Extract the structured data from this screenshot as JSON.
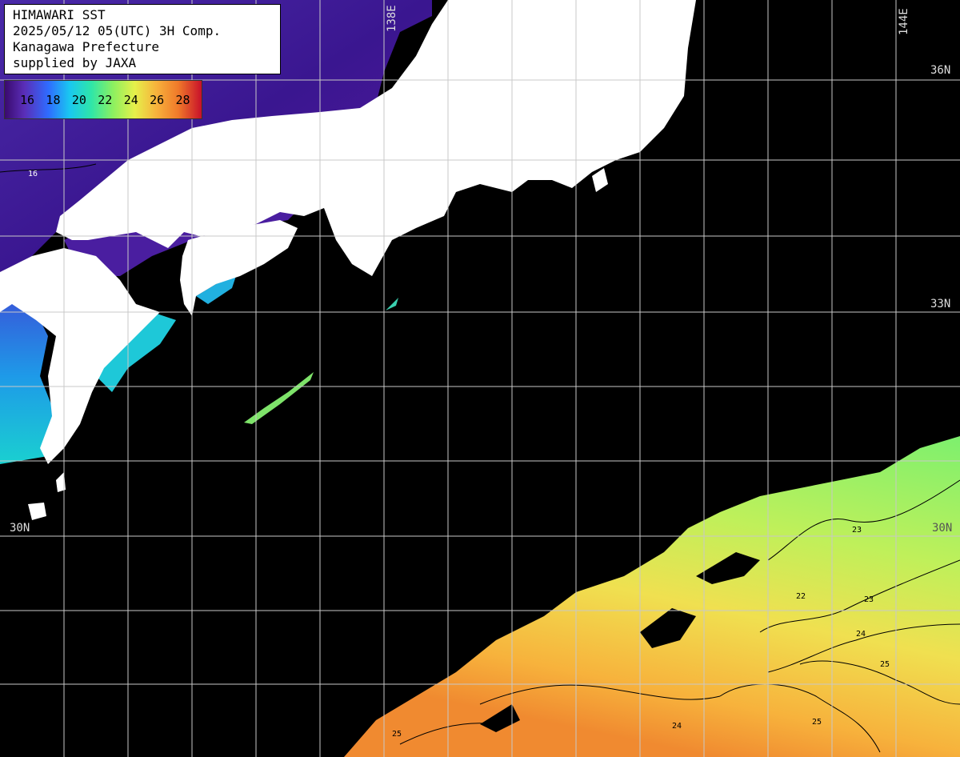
{
  "header": {
    "line1": "HIMAWARI SST",
    "line2": "2025/05/12 05(UTC) 3H Comp.",
    "line3": "Kanagawa Prefecture",
    "line4": "supplied by JAXA"
  },
  "legend": {
    "values": [
      "16",
      "18",
      "20",
      "22",
      "24",
      "26",
      "28"
    ],
    "colors": [
      "#3a0a6e",
      "#5a2eb8",
      "#2f6bff",
      "#19c8f0",
      "#2fe6a8",
      "#8cf060",
      "#e6f04a",
      "#f7b23c",
      "#f07a2a",
      "#e0401e",
      "#c8102a"
    ]
  },
  "grid_labels": {
    "lon_138": "138E",
    "lon_144": "144E",
    "lat_36": "36N",
    "lat_33": "33N",
    "lat_30_left": "30N",
    "lat_30_right": "30N"
  },
  "contour_labels": [
    "16",
    "22",
    "23",
    "24",
    "25"
  ],
  "colors": {
    "land": "#ffffff",
    "no_data": "#000000",
    "grid": "#c8c8c8"
  }
}
